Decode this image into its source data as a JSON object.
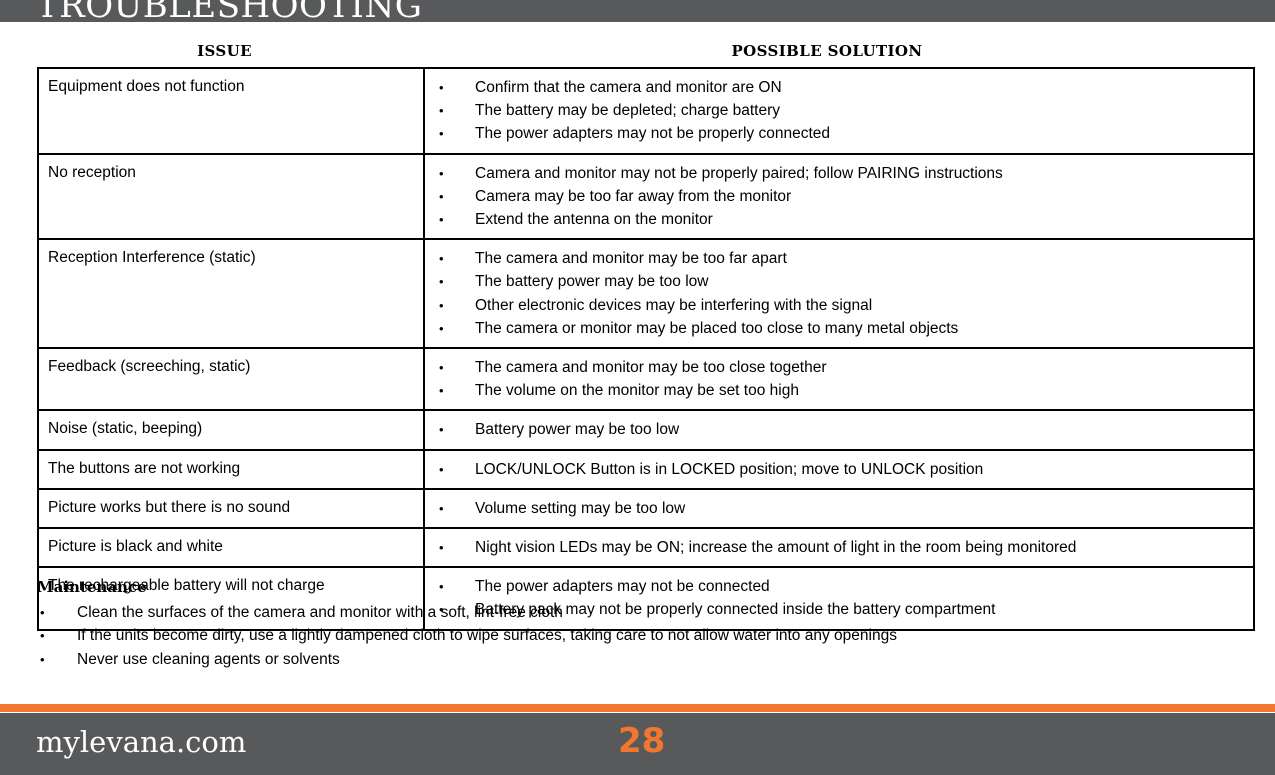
{
  "header": {
    "title": "TROUBLESHOOTING",
    "band_color": "#58595B"
  },
  "table": {
    "columns": [
      {
        "key": "issue",
        "label": "ISSUE"
      },
      {
        "key": "solution",
        "label": "POSSIBLE SOLUTION"
      }
    ],
    "rows": [
      {
        "issue": "Equipment does not function",
        "solutions": [
          "Confirm that the camera and monitor are ON",
          "The battery may be depleted; charge battery",
          "The power adapters may not be properly connected"
        ]
      },
      {
        "issue": "No reception",
        "solutions": [
          "Camera and monitor may not be properly paired; follow PAIRING instructions",
          "Camera may be too far away from the monitor",
          "Extend the antenna on the monitor"
        ]
      },
      {
        "issue": "Reception Interference (static)",
        "solutions": [
          "The camera and monitor may be too far apart",
          "The battery power may be too low",
          "Other electronic devices may be interfering with the signal",
          "The camera or monitor may be placed too close to many metal objects"
        ]
      },
      {
        "issue": "Feedback (screeching, static)",
        "solutions": [
          "The camera and monitor may be too close together",
          "The volume on the monitor may be set too high"
        ]
      },
      {
        "issue": "Noise (static, beeping)",
        "solutions": [
          "Battery power may be too low"
        ]
      },
      {
        "issue": "The buttons are not working",
        "solutions": [
          "LOCK/UNLOCK Button is in LOCKED position; move to UNLOCK position"
        ]
      },
      {
        "issue": "Picture works but there is no sound",
        "solutions": [
          "Volume setting may be too low"
        ]
      },
      {
        "issue": "Picture is black and white",
        "solutions": [
          "Night vision LEDs may be ON; increase the amount of light in the room being monitored"
        ]
      },
      {
        "issue": "The rechargeable battery will not charge",
        "solutions": [
          "The power adapters may not be connected",
          "Battery pack may not be properly connected inside the battery compartment"
        ]
      }
    ]
  },
  "maintenance": {
    "title": "Maintenance",
    "items": [
      "Clean the surfaces of the camera and monitor with a soft, lint-free cloth",
      "If the units become dirty, use a lightly dampened cloth to wipe surfaces, taking care to not allow water into any openings",
      "Never use cleaning agents or solvents"
    ]
  },
  "footer": {
    "website": "mylevana.com",
    "page_number": "28",
    "rule_color": "#F2762E",
    "band_color": "#58595B",
    "page_number_color": "#F2762E"
  }
}
